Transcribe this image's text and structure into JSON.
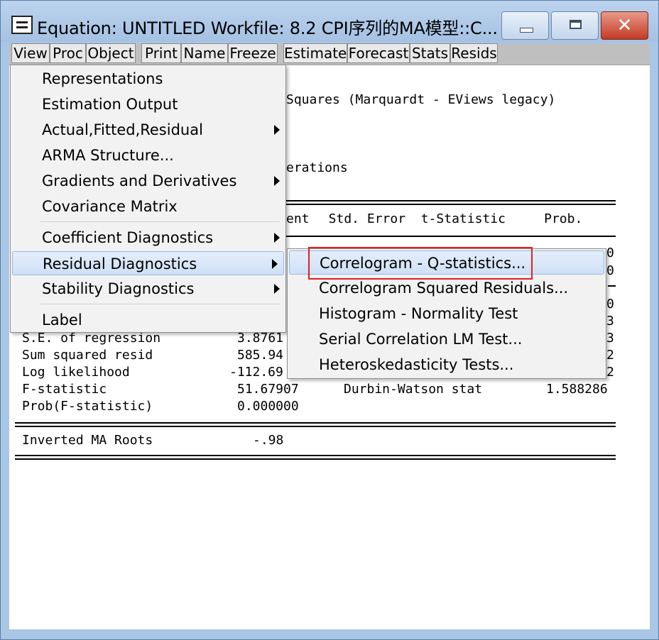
{
  "title": "Equation: UNTITLED   Workfile: 8.2 CPI序列的MA模型::C...",
  "toolbar": [
    "View",
    "Proc",
    "Object",
    "Print",
    "Name",
    "Freeze",
    "Estimate",
    "Forecast",
    "Stats",
    "Resids"
  ],
  "output": {
    "line_method": "Squares (Marquardt - EViews legacy)",
    "line_iter": "erations",
    "col_header_coef": "ent",
    "col_header_rest": "  Std. Error  t-Statistic     Prob.",
    "frag1": "0",
    "frag2": "0",
    "frag3": "0",
    "frag4": "3",
    "frag5": "3",
    "frag6": "2",
    "frag7": "2",
    "stats": [
      {
        "label": "S.E. of regression",
        "value": "3.8761"
      },
      {
        "label": "Sum squared resid",
        "value": "585.94"
      },
      {
        "label": "Log likelihood",
        "value": "-112.69"
      },
      {
        "label": "F-statistic",
        "value": "51.67907"
      },
      {
        "label": "Prob(F-statistic)",
        "value": "0.000000"
      }
    ],
    "dw_label": "Durbin-Watson stat",
    "dw_value": "1.588286",
    "roots_label": "Inverted MA Roots",
    "roots_value": "-.98"
  },
  "view_menu": [
    {
      "label": "Representations",
      "submenu": false
    },
    {
      "label": "Estimation Output",
      "submenu": false
    },
    {
      "label": "Actual,Fitted,Residual",
      "submenu": true
    },
    {
      "label": "ARMA Structure...",
      "submenu": false
    },
    {
      "label": "Gradients and Derivatives",
      "submenu": true
    },
    {
      "label": "Covariance Matrix",
      "submenu": false
    },
    {
      "label": "Coefficient Diagnostics",
      "submenu": true
    },
    {
      "label": "Residual Diagnostics",
      "submenu": true
    },
    {
      "label": "Stability Diagnostics",
      "submenu": true
    },
    {
      "label": "Label",
      "submenu": false
    }
  ],
  "residual_submenu": [
    {
      "label": "Correlogram - Q-statistics..."
    },
    {
      "label": "Correlogram Squared Residuals..."
    },
    {
      "label": "Histogram - Normality Test"
    },
    {
      "label": "Serial Correlation LM Test..."
    },
    {
      "label": "Heteroskedasticity Tests..."
    }
  ],
  "highlight_color": "#e02020"
}
